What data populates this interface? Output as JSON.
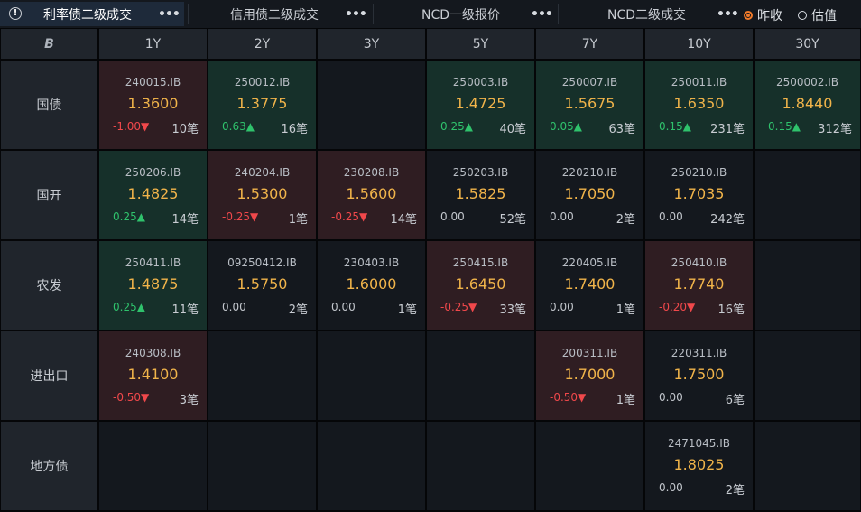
{
  "tabs": [
    {
      "label": "利率债二级成交",
      "more": "•••",
      "active": true
    },
    {
      "label": "信用债二级成交",
      "more": "•••",
      "active": false
    },
    {
      "label": "NCD一级报价",
      "more": "•••",
      "active": false
    },
    {
      "label": "NCD二级成交",
      "more": "•••",
      "active": false
    }
  ],
  "info_icon": "!",
  "radios": [
    {
      "label": "昨收",
      "checked": true
    },
    {
      "label": "估值",
      "checked": false
    }
  ],
  "corner_icon": "B",
  "tenors": [
    "1Y",
    "2Y",
    "3Y",
    "5Y",
    "7Y",
    "10Y",
    "30Y"
  ],
  "rows": [
    {
      "label": "国债",
      "cells": [
        {
          "code": "240015.IB",
          "price": "1.3600",
          "change": "-1.00▼",
          "count": "10笔",
          "trend": "down"
        },
        {
          "code": "250012.IB",
          "price": "1.3775",
          "change": "0.63▲",
          "count": "16笔",
          "trend": "up"
        },
        null,
        {
          "code": "250003.IB",
          "price": "1.4725",
          "change": "0.25▲",
          "count": "40笔",
          "trend": "up"
        },
        {
          "code": "250007.IB",
          "price": "1.5675",
          "change": "0.05▲",
          "count": "63笔",
          "trend": "up"
        },
        {
          "code": "250011.IB",
          "price": "1.6350",
          "change": "0.15▲",
          "count": "231笔",
          "trend": "up"
        },
        {
          "code": "2500002.IB",
          "price": "1.8440",
          "change": "0.15▲",
          "count": "312笔",
          "trend": "up"
        }
      ]
    },
    {
      "label": "国开",
      "cells": [
        {
          "code": "250206.IB",
          "price": "1.4825",
          "change": "0.25▲",
          "count": "14笔",
          "trend": "up"
        },
        {
          "code": "240204.IB",
          "price": "1.5300",
          "change": "-0.25▼",
          "count": "1笔",
          "trend": "down"
        },
        {
          "code": "230208.IB",
          "price": "1.5600",
          "change": "-0.25▼",
          "count": "14笔",
          "trend": "down"
        },
        {
          "code": "250203.IB",
          "price": "1.5825",
          "change": "0.00",
          "count": "52笔",
          "trend": "flat"
        },
        {
          "code": "220210.IB",
          "price": "1.7050",
          "change": "0.00",
          "count": "2笔",
          "trend": "flat"
        },
        {
          "code": "250210.IB",
          "price": "1.7035",
          "change": "0.00",
          "count": "242笔",
          "trend": "flat"
        },
        null
      ]
    },
    {
      "label": "农发",
      "cells": [
        {
          "code": "250411.IB",
          "price": "1.4875",
          "change": "0.25▲",
          "count": "11笔",
          "trend": "up"
        },
        {
          "code": "09250412.IB",
          "price": "1.5750",
          "change": "0.00",
          "count": "2笔",
          "trend": "flat"
        },
        {
          "code": "230403.IB",
          "price": "1.6000",
          "change": "0.00",
          "count": "1笔",
          "trend": "flat"
        },
        {
          "code": "250415.IB",
          "price": "1.6450",
          "change": "-0.25▼",
          "count": "33笔",
          "trend": "down"
        },
        {
          "code": "220405.IB",
          "price": "1.7400",
          "change": "0.00",
          "count": "1笔",
          "trend": "flat"
        },
        {
          "code": "250410.IB",
          "price": "1.7740",
          "change": "-0.20▼",
          "count": "16笔",
          "trend": "down"
        },
        null
      ]
    },
    {
      "label": "进出口",
      "cells": [
        {
          "code": "240308.IB",
          "price": "1.4100",
          "change": "-0.50▼",
          "count": "3笔",
          "trend": "down"
        },
        null,
        null,
        null,
        {
          "code": "200311.IB",
          "price": "1.7000",
          "change": "-0.50▼",
          "count": "1笔",
          "trend": "down"
        },
        {
          "code": "220311.IB",
          "price": "1.7500",
          "change": "0.00",
          "count": "6笔",
          "trend": "flat"
        },
        null
      ]
    },
    {
      "label": "地方债",
      "cells": [
        null,
        null,
        null,
        null,
        null,
        {
          "code": "2471045.IB",
          "price": "1.8025",
          "change": "0.00",
          "count": "2笔",
          "trend": "flat"
        },
        null
      ]
    }
  ]
}
